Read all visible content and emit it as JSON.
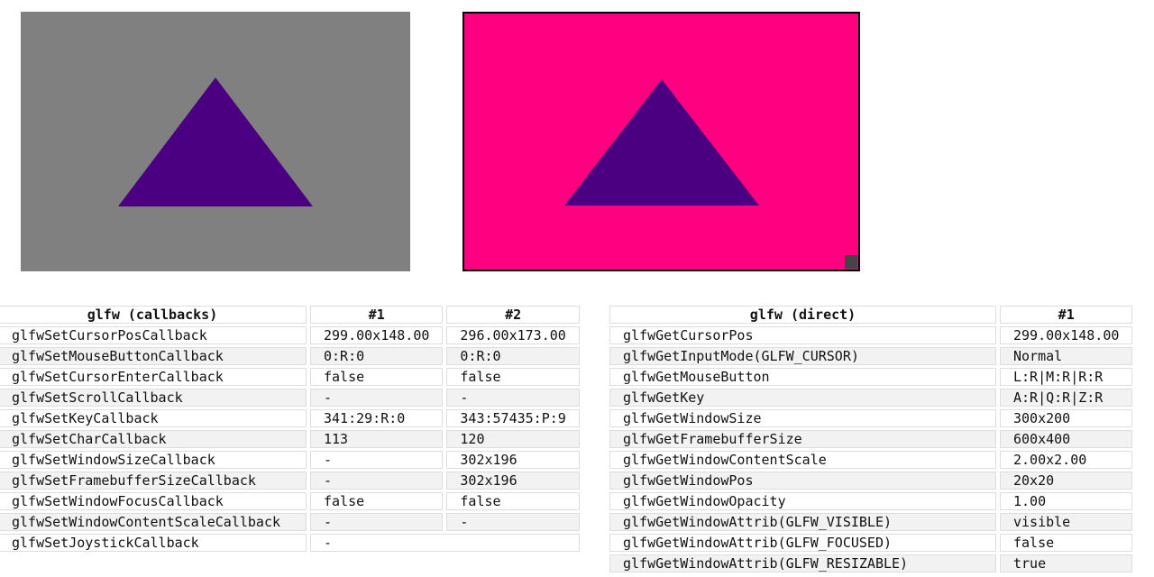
{
  "colors": {
    "canvas1_bg": "#808080",
    "canvas2_bg": "#ff0080",
    "triangle": "#4b0082"
  },
  "callbacks": {
    "headers": [
      "glfw (callbacks)",
      "#1",
      "#2"
    ],
    "rows": [
      [
        "glfwSetCursorPosCallback",
        "299.00x148.00",
        "296.00x173.00"
      ],
      [
        "glfwSetMouseButtonCallback",
        "0:R:0",
        "0:R:0"
      ],
      [
        "glfwSetCursorEnterCallback",
        "false",
        "false"
      ],
      [
        "glfwSetScrollCallback",
        "-",
        "-"
      ],
      [
        "glfwSetKeyCallback",
        "341:29:R:0",
        "343:57435:P:9"
      ],
      [
        "glfwSetCharCallback",
        "113",
        "120"
      ],
      [
        "glfwSetWindowSizeCallback",
        "-",
        "302x196"
      ],
      [
        "glfwSetFramebufferSizeCallback",
        "-",
        "302x196"
      ],
      [
        "glfwSetWindowFocusCallback",
        "false",
        "false"
      ],
      [
        "glfwSetWindowContentScaleCallback",
        "-",
        "-"
      ],
      [
        "glfwSetJoystickCallback",
        "-"
      ]
    ]
  },
  "direct": {
    "headers": [
      "glfw (direct)",
      "#1"
    ],
    "rows": [
      [
        "glfwGetCursorPos",
        "299.00x148.00"
      ],
      [
        "glfwGetInputMode(GLFW_CURSOR)",
        "Normal"
      ],
      [
        "glfwGetMouseButton",
        "L:R|M:R|R:R"
      ],
      [
        "glfwGetKey",
        "A:R|Q:R|Z:R"
      ],
      [
        "glfwGetWindowSize",
        "300x200"
      ],
      [
        "glfwGetFramebufferSize",
        "600x400"
      ],
      [
        "glfwGetWindowContentScale",
        "2.00x2.00"
      ],
      [
        "glfwGetWindowPos",
        "20x20"
      ],
      [
        "glfwGetWindowOpacity",
        "1.00"
      ],
      [
        "glfwGetWindowAttrib(GLFW_VISIBLE)",
        "visible"
      ],
      [
        "glfwGetWindowAttrib(GLFW_FOCUSED)",
        "false"
      ],
      [
        "glfwGetWindowAttrib(GLFW_RESIZABLE)",
        "true"
      ]
    ]
  }
}
